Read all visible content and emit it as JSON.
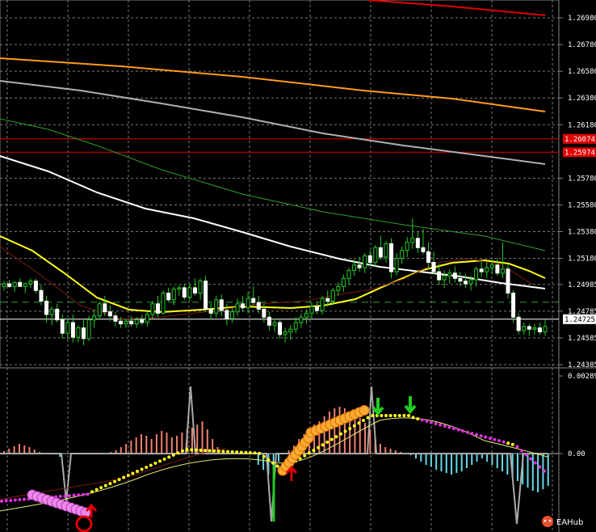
{
  "chart_data": [
    {
      "type": "candlestick",
      "panel": "price",
      "y_axis_ticks": [
        "1.26980",
        "1.26780",
        "1.26580",
        "1.26380",
        "1.26180",
        "1.25780",
        "1.25580",
        "1.25380",
        "1.25180",
        "1.24985",
        "1.24785",
        "1.24585",
        "1.24385"
      ],
      "price_tags": [
        {
          "label": "1.26074",
          "value": 1.26074,
          "color": "#e00000"
        },
        {
          "label": "1.25974",
          "value": 1.25974,
          "color": "#e00000"
        },
        {
          "label": "1.24725",
          "value": 1.24725,
          "color": "#ffffff"
        }
      ],
      "horizontal_lines": [
        {
          "value": 1.26074,
          "color": "#e00000",
          "style": "solid"
        },
        {
          "value": 1.25974,
          "color": "#e00000",
          "style": "solid"
        },
        {
          "value": 1.24725,
          "color": "#ffffff",
          "style": "solid"
        },
        {
          "value": 1.24852,
          "color": "#2ea02e",
          "style": "dashed"
        }
      ],
      "ylim": [
        1.24385,
        1.2708
      ],
      "grid": true,
      "candles": [
        [
          1.2497,
          1.2501,
          1.2494,
          1.2499
        ],
        [
          1.2499,
          1.2502,
          1.2496,
          1.2497
        ],
        [
          1.2497,
          1.2501,
          1.2493,
          1.25
        ],
        [
          1.25,
          1.2503,
          1.2497,
          1.2497
        ],
        [
          1.2497,
          1.25,
          1.2492,
          1.2499
        ],
        [
          1.2499,
          1.2503,
          1.2496,
          1.2501
        ],
        [
          1.2501,
          1.2503,
          1.2492,
          1.2494
        ],
        [
          1.2494,
          1.2498,
          1.2483,
          1.2486
        ],
        [
          1.2486,
          1.249,
          1.247,
          1.2476
        ],
        [
          1.2476,
          1.2482,
          1.2468,
          1.248
        ],
        [
          1.248,
          1.2484,
          1.247,
          1.2472
        ],
        [
          1.2472,
          1.2476,
          1.2458,
          1.2462
        ],
        [
          1.2462,
          1.2473,
          1.2457,
          1.247
        ],
        [
          1.247,
          1.2476,
          1.2455,
          1.2459
        ],
        [
          1.2459,
          1.2468,
          1.2455,
          1.2466
        ],
        [
          1.2466,
          1.2472,
          1.2453,
          1.2458
        ],
        [
          1.2458,
          1.2475,
          1.2456,
          1.2472
        ],
        [
          1.2472,
          1.248,
          1.2466,
          1.2475
        ],
        [
          1.2475,
          1.2486,
          1.2472,
          1.2484
        ],
        [
          1.2484,
          1.249,
          1.2475,
          1.2478
        ],
        [
          1.2478,
          1.2483,
          1.2471,
          1.2475
        ],
        [
          1.2475,
          1.2478,
          1.2467,
          1.2471
        ],
        [
          1.2471,
          1.2474,
          1.2466,
          1.2469
        ],
        [
          1.2469,
          1.2473,
          1.2466,
          1.2471
        ],
        [
          1.2471,
          1.2475,
          1.2467,
          1.2469
        ],
        [
          1.2469,
          1.2474,
          1.2466,
          1.2472
        ],
        [
          1.2472,
          1.2476,
          1.2468,
          1.247
        ],
        [
          1.247,
          1.2478,
          1.2467,
          1.2476
        ],
        [
          1.2476,
          1.2486,
          1.2473,
          1.2484
        ],
        [
          1.2484,
          1.249,
          1.2474,
          1.2477
        ],
        [
          1.2477,
          1.2494,
          1.2476,
          1.2492
        ],
        [
          1.2492,
          1.2496,
          1.2485,
          1.2487
        ],
        [
          1.2487,
          1.2497,
          1.2483,
          1.2495
        ],
        [
          1.2495,
          1.2498,
          1.249,
          1.2496
        ],
        [
          1.2496,
          1.2499,
          1.2487,
          1.2489
        ],
        [
          1.2489,
          1.2499,
          1.2486,
          1.2496
        ],
        [
          1.2496,
          1.2503,
          1.249,
          1.2492
        ],
        [
          1.2492,
          1.2503,
          1.2487,
          1.2501
        ],
        [
          1.2501,
          1.2505,
          1.2478,
          1.248
        ],
        [
          1.248,
          1.2486,
          1.2472,
          1.2477
        ],
        [
          1.2477,
          1.249,
          1.2474,
          1.2487
        ],
        [
          1.2487,
          1.2491,
          1.2475,
          1.2479
        ],
        [
          1.2479,
          1.2484,
          1.2468,
          1.2473
        ],
        [
          1.2473,
          1.2481,
          1.247,
          1.2478
        ],
        [
          1.2478,
          1.2488,
          1.2475,
          1.2484
        ],
        [
          1.2484,
          1.249,
          1.2478,
          1.2481
        ],
        [
          1.2481,
          1.2493,
          1.2477,
          1.2488
        ],
        [
          1.2488,
          1.2497,
          1.2483,
          1.2485
        ],
        [
          1.2485,
          1.249,
          1.2477,
          1.248
        ],
        [
          1.248,
          1.2484,
          1.247,
          1.2474
        ],
        [
          1.2474,
          1.2478,
          1.2464,
          1.2468
        ],
        [
          1.2468,
          1.2473,
          1.2463,
          1.247
        ],
        [
          1.247,
          1.2472,
          1.2458,
          1.2461
        ],
        [
          1.2461,
          1.2466,
          1.2455,
          1.2463
        ],
        [
          1.2463,
          1.2468,
          1.2457,
          1.2465
        ],
        [
          1.2465,
          1.2474,
          1.2462,
          1.247
        ],
        [
          1.247,
          1.2477,
          1.2466,
          1.2474
        ],
        [
          1.2474,
          1.248,
          1.2469,
          1.2477
        ],
        [
          1.2477,
          1.2485,
          1.2472,
          1.2482
        ],
        [
          1.2482,
          1.2486,
          1.2476,
          1.2479
        ],
        [
          1.2479,
          1.249,
          1.2476,
          1.2488
        ],
        [
          1.2488,
          1.2494,
          1.2482,
          1.2486
        ],
        [
          1.2486,
          1.2496,
          1.2483,
          1.2494
        ],
        [
          1.2494,
          1.25,
          1.249,
          1.2497
        ],
        [
          1.2497,
          1.2506,
          1.2493,
          1.2503
        ],
        [
          1.2503,
          1.2511,
          1.2498,
          1.2509
        ],
        [
          1.2509,
          1.2517,
          1.2505,
          1.2513
        ],
        [
          1.2513,
          1.2519,
          1.2508,
          1.2511
        ],
        [
          1.2511,
          1.2522,
          1.2507,
          1.252
        ],
        [
          1.252,
          1.2524,
          1.2512,
          1.2515
        ],
        [
          1.2515,
          1.2528,
          1.2512,
          1.2526
        ],
        [
          1.2526,
          1.2535,
          1.2517,
          1.2519
        ],
        [
          1.2519,
          1.2531,
          1.2515,
          1.2529
        ],
        [
          1.2529,
          1.2533,
          1.2503,
          1.2508
        ],
        [
          1.2508,
          1.2522,
          1.2505,
          1.2518
        ],
        [
          1.2518,
          1.2527,
          1.2514,
          1.2524
        ],
        [
          1.2524,
          1.2534,
          1.2519,
          1.253
        ],
        [
          1.253,
          1.2548,
          1.2525,
          1.2533
        ],
        [
          1.2533,
          1.2538,
          1.2522,
          1.2526
        ],
        [
          1.2526,
          1.254,
          1.2521,
          1.2523
        ],
        [
          1.2523,
          1.253,
          1.251,
          1.2515
        ],
        [
          1.2515,
          1.2523,
          1.2506,
          1.2508
        ],
        [
          1.2508,
          1.2514,
          1.2498,
          1.2502
        ],
        [
          1.2502,
          1.2509,
          1.2496,
          1.2505
        ],
        [
          1.2505,
          1.251,
          1.2499,
          1.2507
        ],
        [
          1.2507,
          1.2512,
          1.25,
          1.2503
        ],
        [
          1.2503,
          1.2508,
          1.2497,
          1.2501
        ],
        [
          1.2501,
          1.2506,
          1.2496,
          1.2499
        ],
        [
          1.2499,
          1.2505,
          1.2494,
          1.2502
        ],
        [
          1.2502,
          1.2512,
          1.2497,
          1.251
        ],
        [
          1.251,
          1.2516,
          1.2504,
          1.2508
        ],
        [
          1.2508,
          1.2515,
          1.2503,
          1.2511
        ],
        [
          1.2511,
          1.2517,
          1.2506,
          1.2513
        ],
        [
          1.2513,
          1.2518,
          1.2505,
          1.2507
        ],
        [
          1.2507,
          1.253,
          1.2503,
          1.251
        ],
        [
          1.251,
          1.2514,
          1.2488,
          1.2492
        ],
        [
          1.2492,
          1.2494,
          1.247,
          1.2474
        ],
        [
          1.2474,
          1.2477,
          1.2461,
          1.2464
        ],
        [
          1.2464,
          1.247,
          1.2461,
          1.2467
        ],
        [
          1.2467,
          1.2469,
          1.246,
          1.2465
        ],
        [
          1.2465,
          1.2469,
          1.2461,
          1.2466
        ],
        [
          1.2466,
          1.247,
          1.2461,
          1.2463
        ],
        [
          1.2463,
          1.2472,
          1.246,
          1.2467
        ]
      ],
      "moving_averages": [
        {
          "color": "#e00000",
          "values": [
            1.271,
            1.27
          ]
        },
        {
          "color": "#ff9a1a",
          "values": [
            1.2672,
            1.263
          ]
        },
        {
          "color": "#b0b0b0",
          "values": [
            1.2655,
            1.2586
          ]
        },
        {
          "color": "#2ea02e",
          "values": [
            1.2624,
            1.2525
          ]
        },
        {
          "color": "#ffffff",
          "values": [
            1.2587,
            1.2494
          ]
        },
        {
          "color": "#ffff1a",
          "values": [
            1.2533,
            1.2505
          ]
        }
      ]
    },
    {
      "type": "bar",
      "panel": "oscillator",
      "y_axis_ticks": [
        "0.002894",
        "0.00"
      ],
      "ylim": [
        -0.003,
        0.003
      ],
      "histogram_colors": {
        "positive": "#f08070",
        "negative": "#66d9e8"
      }
    }
  ],
  "watermark": {
    "label": "EAHub",
    "icon": "eahub-logo-icon"
  }
}
